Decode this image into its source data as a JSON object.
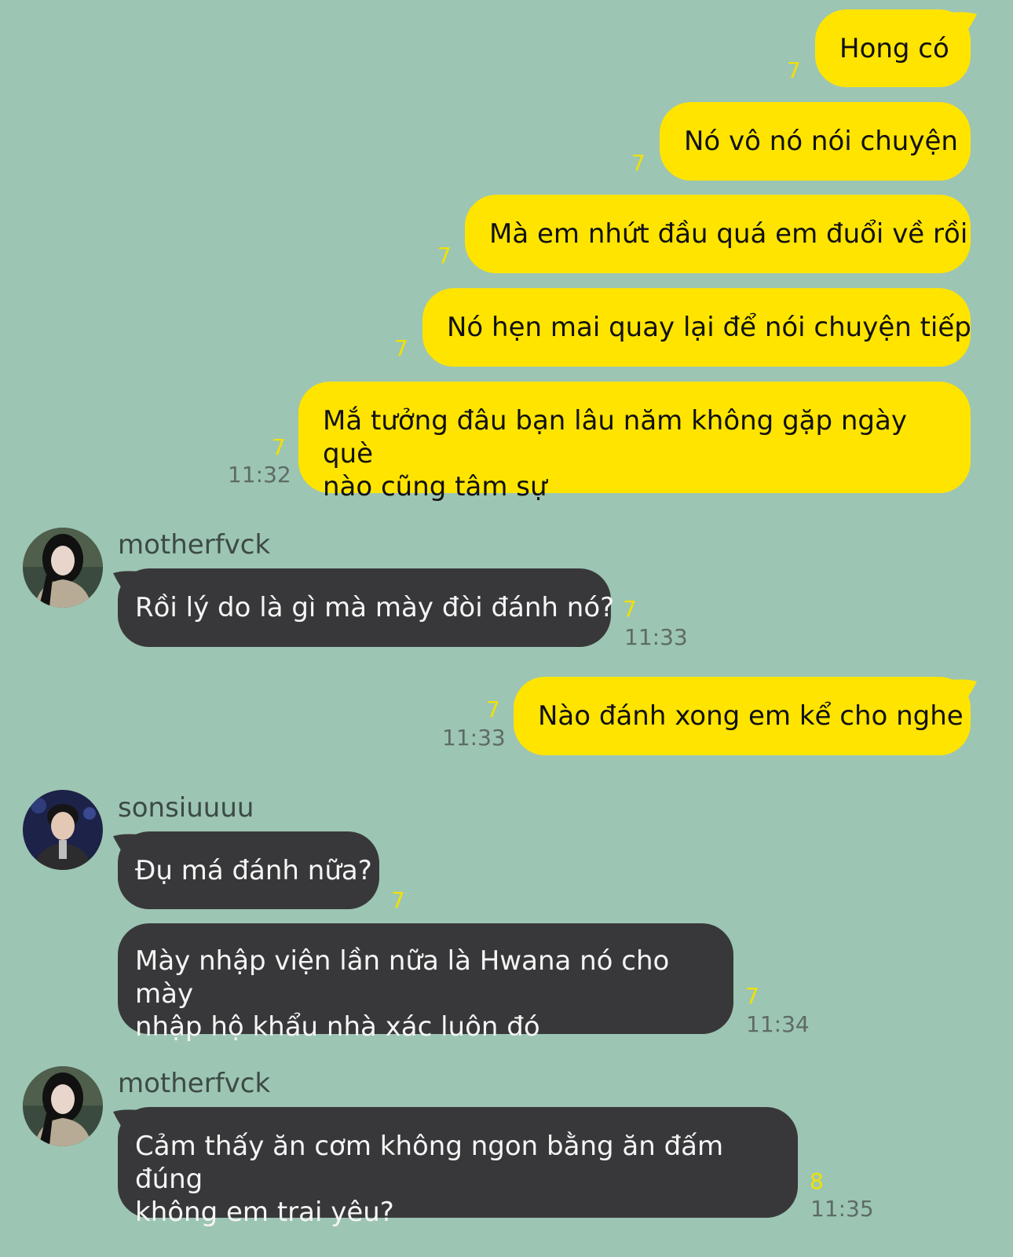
{
  "colors": {
    "background": "#9dc5b3",
    "outgoing_bubble": "#ffe400",
    "incoming_bubble": "#38383a",
    "unread_count": "#f1e100",
    "timestamp": "#5d6b66"
  },
  "messages": [
    {
      "text": "Hong có",
      "unread": "7"
    },
    {
      "text": "Nó vô nó nói chuyện",
      "unread": "7"
    },
    {
      "text": "Mà em nhứt đầu quá em đuổi về rồi",
      "unread": "7"
    },
    {
      "text": "Nó hẹn mai quay lại để nói chuyện tiếp",
      "unread": "7"
    },
    {
      "text": "Mắ tưởng đâu bạn lâu năm không gặp ngày què\nnào cũng tâm sự",
      "unread": "7",
      "time": "11:32"
    },
    {
      "sender": "motherfvck",
      "text": "Rồi lý do là gì mà mày đòi đánh nó?",
      "unread": "7",
      "time": "11:33"
    },
    {
      "text": "Nào đánh xong em kể cho nghe",
      "unread": "7",
      "time": "11:33"
    },
    {
      "sender": "sonsiuuuu",
      "text": "Đụ má đánh nữa?",
      "unread": "7"
    },
    {
      "text": "Mày nhập viện lần nữa là Hwana nó cho mày\nnhập hộ khẩu nhà xác luôn đó",
      "unread": "7",
      "time": "11:34"
    },
    {
      "sender": "motherfvck",
      "text": "Cảm thấy ăn cơm không ngon bằng ăn đấm đúng\nkhông em trai yêu?",
      "unread": "8",
      "time": "11:35"
    }
  ]
}
